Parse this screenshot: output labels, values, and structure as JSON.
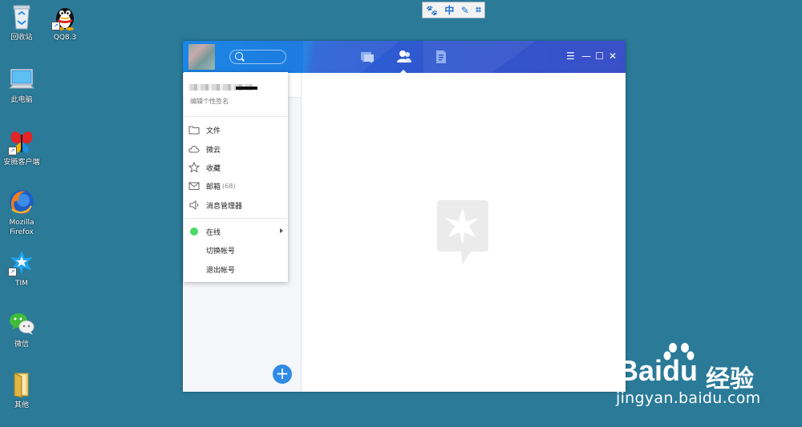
{
  "desktop": {
    "icons": [
      {
        "name": "recycle-bin",
        "label": "回收站"
      },
      {
        "name": "qq",
        "label": "QQ8.3"
      },
      {
        "name": "this-pc",
        "label": "此电脑"
      },
      {
        "name": "tencent-client",
        "label": "安腾客户端"
      },
      {
        "name": "firefox",
        "label_line1": "Mozilla",
        "label_line2": "Firefox"
      },
      {
        "name": "tim",
        "label": "TIM"
      },
      {
        "name": "wechat",
        "label": "微信"
      },
      {
        "name": "other-folder",
        "label": "其他"
      }
    ]
  },
  "ime_bar": {
    "paw": "🐾",
    "mode": "中",
    "pen": "✎",
    "crop": "⌗"
  },
  "tim": {
    "window_controls": {
      "menu": "☰",
      "min": "—",
      "max": "☐",
      "close": "✕"
    },
    "menu": {
      "signature_placeholder": "编辑个性签名",
      "items": [
        {
          "label": "文件"
        },
        {
          "label": "微云"
        },
        {
          "label": "收藏"
        },
        {
          "label": "邮箱",
          "count": "(68)"
        },
        {
          "label": "消息管理器"
        }
      ],
      "status": {
        "label": "在线",
        "color": "#4cd964"
      },
      "switch_account": "切换帐号",
      "logout": "退出帐号"
    },
    "add_button": "+",
    "accent": "#2f8be6"
  },
  "watermark": {
    "brand": "Bai",
    "brand2": "du",
    "jingyan": "经验",
    "url": "jingyan.baidu.com"
  }
}
